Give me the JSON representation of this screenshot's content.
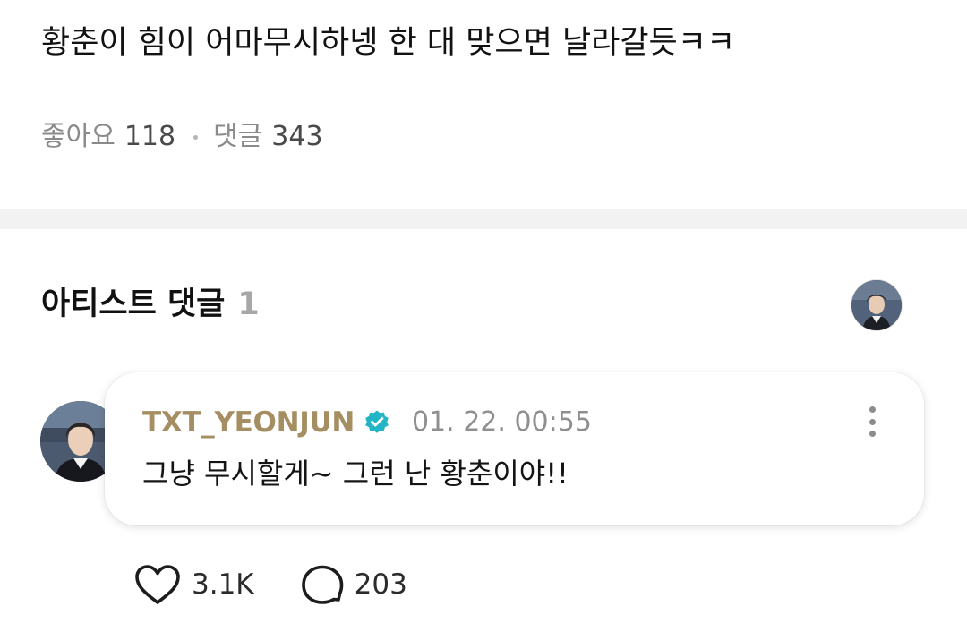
{
  "post": {
    "text": "황춘이 힘이 어마무시하넹 한 대 맞으면 날라갈듯ㅋㅋ",
    "likes_label": "좋아요",
    "likes_count": "118",
    "comments_label": "댓글",
    "comments_count": "343"
  },
  "artist_comments": {
    "title": "아티스트 댓글",
    "count": "1"
  },
  "comment": {
    "username": "TXT_YEONJUN",
    "verified": true,
    "timestamp": "01. 22. 00:55",
    "text": "그냥 무시할게~ 그런 난 황춘이야!!",
    "likes": "3.1K",
    "replies": "203"
  },
  "colors": {
    "username": "#a58e62",
    "verified_badge": "#21b5c6",
    "divider": "#f2f2f2"
  },
  "icons": [
    "heart-icon",
    "comment-bubble-icon",
    "more-vertical-icon",
    "verified-badge-icon"
  ]
}
